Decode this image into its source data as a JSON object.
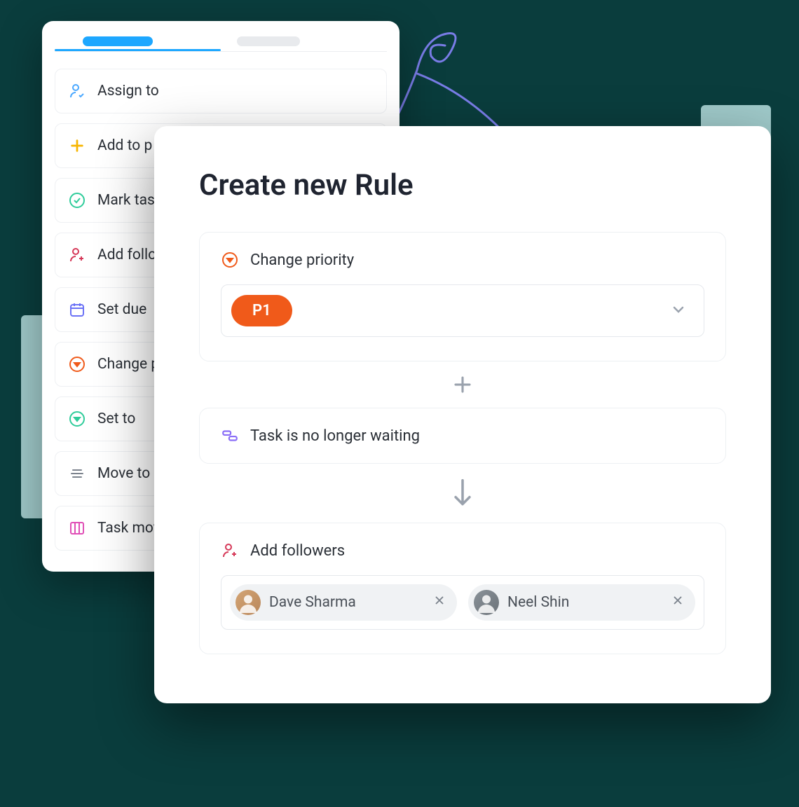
{
  "back": {
    "items": [
      {
        "label": "Assign to"
      },
      {
        "label": "Add to p"
      },
      {
        "label": "Mark tas"
      },
      {
        "label": "Add follo"
      },
      {
        "label": "Set due "
      },
      {
        "label": "Change p"
      },
      {
        "label": "Set to"
      },
      {
        "label": "Move to"
      },
      {
        "label": "Task mov"
      }
    ]
  },
  "front": {
    "title": "Create new Rule",
    "change_priority": {
      "label": "Change priority",
      "value": "P1"
    },
    "condition": {
      "label": "Task is no longer waiting"
    },
    "add_followers": {
      "label": "Add followers",
      "chips": [
        {
          "name": "Dave Sharma"
        },
        {
          "name": "Neel Shin"
        }
      ]
    }
  }
}
